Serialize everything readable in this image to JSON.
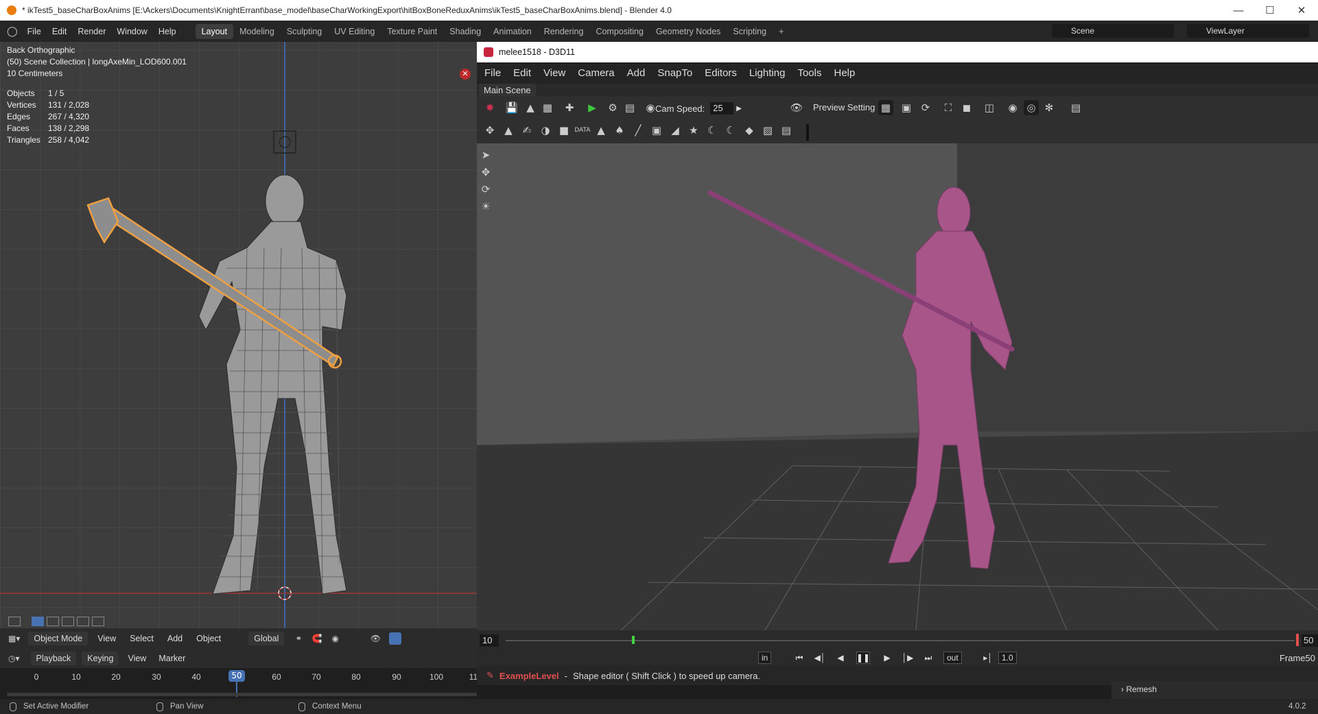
{
  "blender": {
    "window_title": "* ikTest5_baseCharBoxAnims [E:\\Ackers\\Documents\\KnightErrant\\base_model\\baseCharWorkingExport\\hitBoxBoneReduxAnims\\ikTest5_baseCharBoxAnims.blend] - Blender 4.0",
    "menus": [
      "File",
      "Edit",
      "Render",
      "Window",
      "Help"
    ],
    "workspaces": [
      "Layout",
      "Modeling",
      "Sculpting",
      "UV Editing",
      "Texture Paint",
      "Shading",
      "Animation",
      "Rendering",
      "Compositing",
      "Geometry Nodes",
      "Scripting",
      "+"
    ],
    "active_workspace": "Layout",
    "scene": "Scene",
    "view_layer": "ViewLayer",
    "viewport": {
      "view_name": "Back Orthographic",
      "collection": "(50) Scene Collection | longAxeMin_LOD600.001",
      "scale": "10 Centimeters",
      "stats": [
        {
          "k": "Objects",
          "v": "1 / 5"
        },
        {
          "k": "Vertices",
          "v": "131 / 2,028"
        },
        {
          "k": "Edges",
          "v": "267 / 4,320"
        },
        {
          "k": "Faces",
          "v": "138 / 2,298"
        },
        {
          "k": "Triangles",
          "v": "258 / 4,042"
        }
      ]
    },
    "viewport_header": {
      "mode": "Object Mode",
      "menus": [
        "View",
        "Select",
        "Add",
        "Object"
      ],
      "orientation": "Global"
    },
    "timeline_header": {
      "menus": [
        "Playback",
        "Keying",
        "View",
        "Marker"
      ]
    },
    "timeline": {
      "ticks": [
        "0",
        "10",
        "20",
        "30",
        "40",
        "50",
        "60",
        "70",
        "80",
        "90",
        "100",
        "11"
      ],
      "current_frame": "50"
    },
    "status": {
      "left": "Set Active Modifier",
      "middle": "Pan View",
      "right": "Context Menu",
      "version": "4.0.2"
    }
  },
  "torque": {
    "window_title": "melee1518 - D3D11",
    "menus": [
      "File",
      "Edit",
      "View",
      "Camera",
      "Add",
      "SnapTo",
      "Editors",
      "Lighting",
      "Tools",
      "Help"
    ],
    "tab": "Main Scene",
    "cam_speed_label": "Cam Speed:",
    "cam_speed_value": "25",
    "preview_settings": "Preview Setting",
    "scrub": {
      "start": "10",
      "end": "50",
      "in": "in",
      "out": "out",
      "speed": "1.0",
      "frame_label": "Frame50",
      "progress": 0.16
    },
    "status_level": "ExampleLevel",
    "status_sep": "-",
    "status_msg": "Shape editor ( Shift Click ) to speed up camera.",
    "remesh": "Remesh"
  },
  "colors": {
    "selection_orange": "#f0a040",
    "character_pink": "#a8558a",
    "accent_blue": "#4772b3"
  }
}
